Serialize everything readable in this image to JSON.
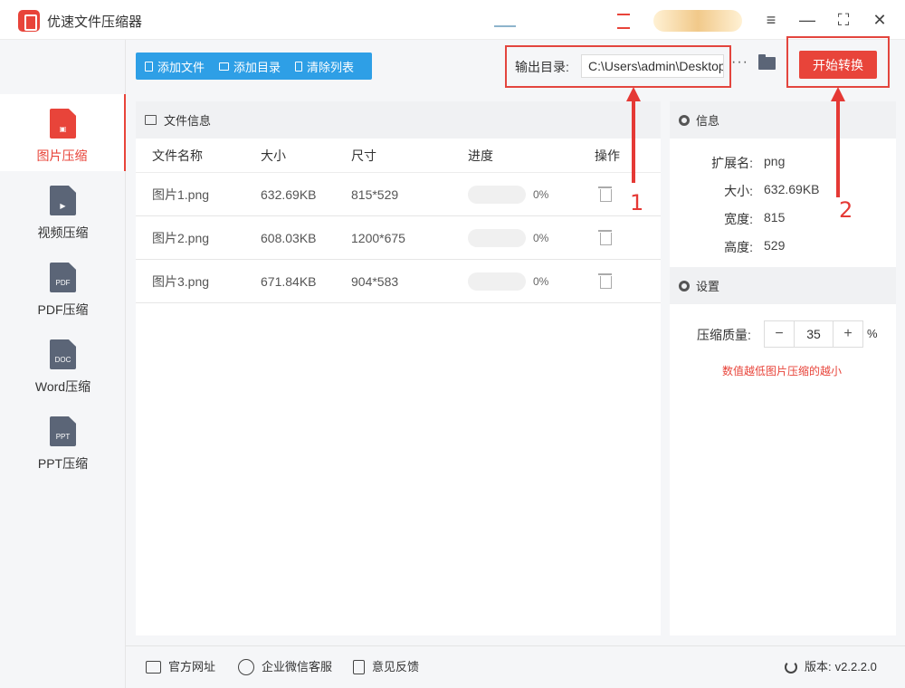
{
  "app": {
    "title": "优速文件压缩器"
  },
  "sidebar": {
    "items": [
      {
        "label": "图片压缩",
        "icon": "image-doc-icon",
        "active": true
      },
      {
        "label": "视频压缩",
        "icon": "video-doc-icon",
        "badge": "▶"
      },
      {
        "label": "PDF压缩",
        "icon": "pdf-doc-icon",
        "badge": "PDF"
      },
      {
        "label": "Word压缩",
        "icon": "word-doc-icon",
        "badge": "DOC"
      },
      {
        "label": "PPT压缩",
        "icon": "ppt-doc-icon",
        "badge": "PPT"
      }
    ]
  },
  "toolbar": {
    "add_file": "添加文件",
    "add_folder": "添加目录",
    "clear_list": "清除列表"
  },
  "output": {
    "label": "输出目录:",
    "path": "C:\\Users\\admin\\Desktop",
    "more": "···"
  },
  "start_button": "开始转换",
  "file_panel": {
    "title": "文件信息",
    "columns": [
      "文件名称",
      "大小",
      "尺寸",
      "进度",
      "操作"
    ],
    "rows": [
      {
        "name": "图片1.png",
        "size": "632.69KB",
        "dims": "815*529",
        "progress": "0%",
        "progress_value": 0
      },
      {
        "name": "图片2.png",
        "size": "608.03KB",
        "dims": "1200*675",
        "progress": "0%",
        "progress_value": 0
      },
      {
        "name": "图片3.png",
        "size": "671.84KB",
        "dims": "904*583",
        "progress": "0%",
        "progress_value": 0
      }
    ]
  },
  "info_panel": {
    "title": "信息",
    "fields": [
      {
        "key": "扩展名:",
        "value": "png"
      },
      {
        "key": "大小:",
        "value": "632.69KB"
      },
      {
        "key": "宽度:",
        "value": "815"
      },
      {
        "key": "高度:",
        "value": "529"
      }
    ]
  },
  "settings": {
    "title": "设置",
    "quality_label": "压缩质量:",
    "quality_value": "35",
    "decrement": "−",
    "increment": "+",
    "unit": "%",
    "hint": "数值越低图片压缩的越小"
  },
  "annotations": {
    "n1": "1",
    "n2": "2"
  },
  "footer": {
    "website": "官方网址",
    "wechat": "企业微信客服",
    "feedback": "意见反馈",
    "version_label": "版本:",
    "version": "v2.2.2.0"
  },
  "colors": {
    "accent": "#e8443a",
    "toolbar_blue": "#2e9fe6",
    "annotation_red": "#e53935"
  }
}
